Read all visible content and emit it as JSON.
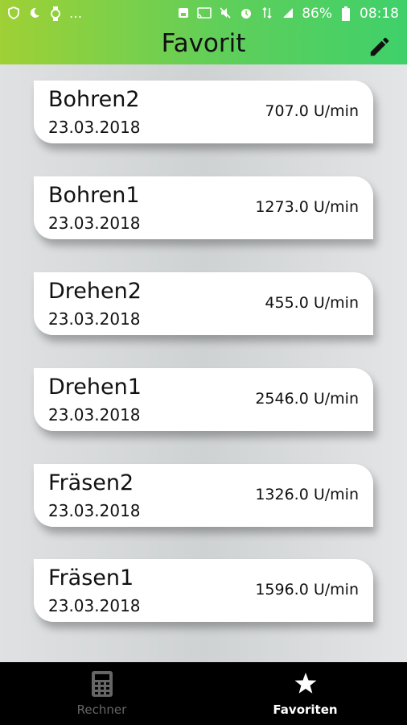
{
  "status_bar": {
    "left_icons": [
      "shield-icon",
      "moon-icon",
      "watch-icon",
      "more-dots-icon"
    ],
    "dots": "...",
    "battery": "86%",
    "time": "08:18"
  },
  "app_bar": {
    "title": "Favorit",
    "edit_icon": "pencil-icon"
  },
  "favorites": [
    {
      "name": "Bohren2",
      "date": "23.03.2018",
      "value": "707.0 U/min"
    },
    {
      "name": "Bohren1",
      "date": "23.03.2018",
      "value": "1273.0 U/min"
    },
    {
      "name": "Drehen2",
      "date": "23.03.2018",
      "value": "455.0 U/min"
    },
    {
      "name": "Drehen1",
      "date": "23.03.2018",
      "value": "2546.0 U/min"
    },
    {
      "name": "Fräsen2",
      "date": "23.03.2018",
      "value": "1326.0 U/min"
    },
    {
      "name": "Fräsen1",
      "date": "23.03.2018",
      "value": "1596.0 U/min"
    }
  ],
  "bottom_nav": {
    "items": [
      {
        "label": "Rechner",
        "icon": "calculator-icon",
        "active": false
      },
      {
        "label": "Favoriten",
        "icon": "star-icon",
        "active": true
      }
    ]
  },
  "colors": {
    "header_gradient_start": "#9fd035",
    "header_gradient_end": "#3fd06a",
    "nav_background": "#000000",
    "nav_active": "#ffffff",
    "nav_inactive": "#666666"
  }
}
